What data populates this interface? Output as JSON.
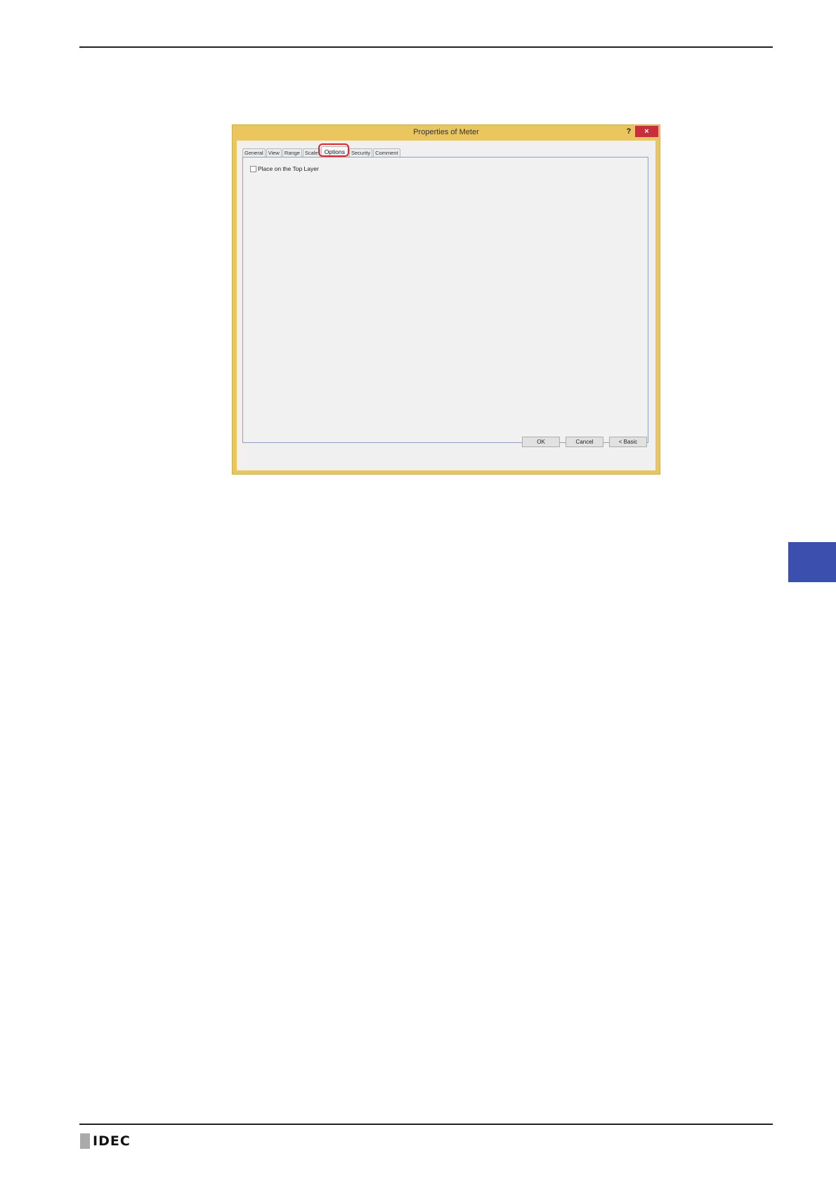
{
  "dialog": {
    "title": "Properties of Meter",
    "help_label": "?",
    "close_label": "×",
    "tabs": [
      {
        "label": "General"
      },
      {
        "label": "View"
      },
      {
        "label": "Range"
      },
      {
        "label": "Scale"
      },
      {
        "label": "Options"
      },
      {
        "label": "Security"
      },
      {
        "label": "Comment"
      }
    ],
    "active_tab": "Options",
    "options": {
      "place_on_top_layer": {
        "label": "Place on the Top Layer",
        "checked": false
      }
    },
    "buttons": {
      "ok": "OK",
      "cancel": "Cancel",
      "basic": "< Basic"
    }
  },
  "footer": {
    "logo_text": "IDEC"
  },
  "colors": {
    "highlight": "#e0262e",
    "side_tab": "#3b4fae",
    "dialog_frame": "#ebc55e"
  }
}
